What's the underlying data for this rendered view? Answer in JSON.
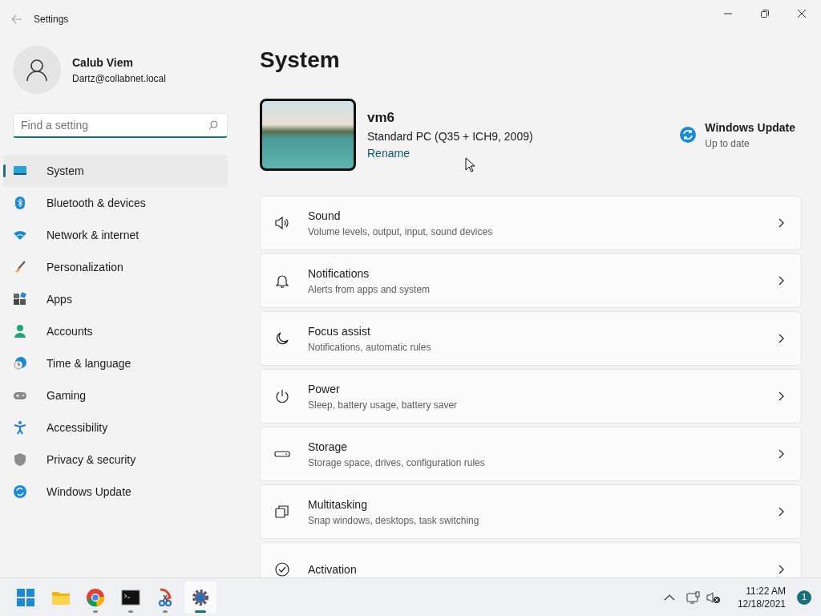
{
  "window": {
    "title": "Settings"
  },
  "user": {
    "name": "Calub Viem",
    "email": "Dartz@collabnet.local"
  },
  "search": {
    "placeholder": "Find a setting"
  },
  "sidebar": {
    "items": [
      {
        "label": "System",
        "selected": true
      },
      {
        "label": "Bluetooth & devices",
        "selected": false
      },
      {
        "label": "Network & internet",
        "selected": false
      },
      {
        "label": "Personalization",
        "selected": false
      },
      {
        "label": "Apps",
        "selected": false
      },
      {
        "label": "Accounts",
        "selected": false
      },
      {
        "label": "Time & language",
        "selected": false
      },
      {
        "label": "Gaming",
        "selected": false
      },
      {
        "label": "Accessibility",
        "selected": false
      },
      {
        "label": "Privacy & security",
        "selected": false
      },
      {
        "label": "Windows Update",
        "selected": false
      }
    ]
  },
  "page": {
    "title": "System"
  },
  "device": {
    "name": "vm6",
    "model": "Standard PC (Q35 + ICH9, 2009)",
    "rename": "Rename"
  },
  "update": {
    "title": "Windows Update",
    "status": "Up to date"
  },
  "settings": [
    {
      "title": "Sound",
      "subtitle": "Volume levels, output, input, sound devices"
    },
    {
      "title": "Notifications",
      "subtitle": "Alerts from apps and system"
    },
    {
      "title": "Focus assist",
      "subtitle": "Notifications, automatic rules"
    },
    {
      "title": "Power",
      "subtitle": "Sleep, battery usage, battery saver"
    },
    {
      "title": "Storage",
      "subtitle": "Storage space, drives, configuration rules"
    },
    {
      "title": "Multitasking",
      "subtitle": "Snap windows, desktops, task switching"
    },
    {
      "title": "Activation"
    }
  ],
  "taskbar": {
    "apps": [
      {
        "running": false,
        "selected": false
      },
      {
        "running": false,
        "selected": false
      },
      {
        "running": true,
        "selected": false
      },
      {
        "running": true,
        "selected": false
      },
      {
        "running": true,
        "selected": false
      },
      {
        "running": true,
        "selected": true
      }
    ]
  },
  "clock": {
    "time": "11:22 AM",
    "date": "12/18/2021"
  },
  "notifications": {
    "count": "1"
  }
}
